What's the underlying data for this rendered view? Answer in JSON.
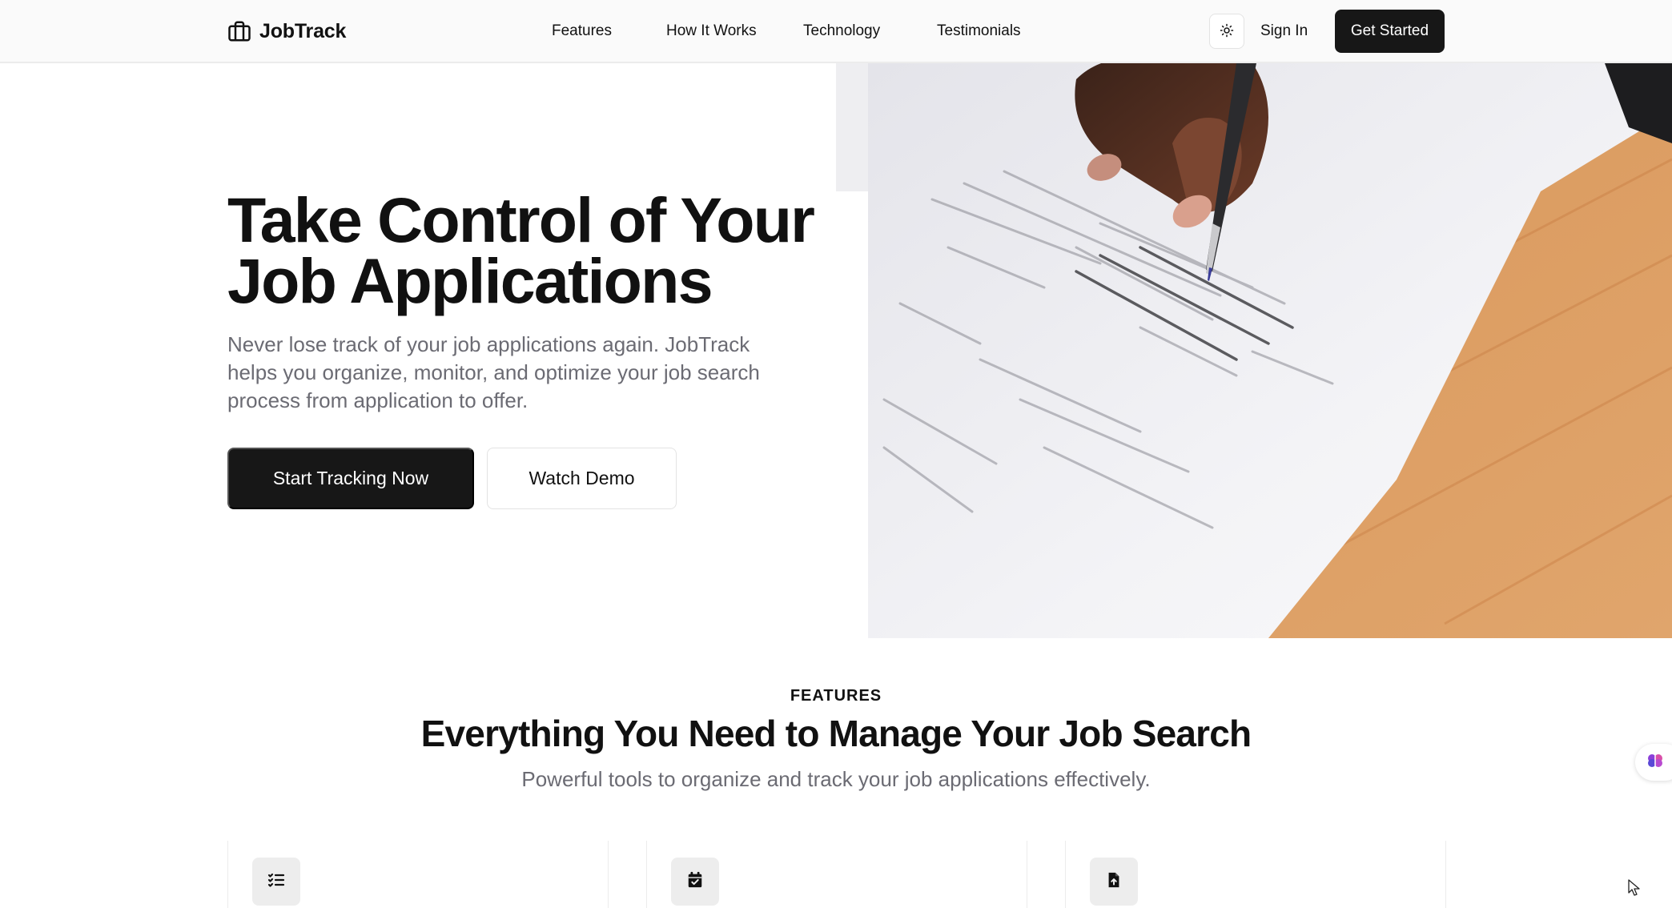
{
  "header": {
    "brand_name": "JobTrack",
    "brand_icon": "briefcase-icon",
    "nav": [
      "Features",
      "How It Works",
      "Technology",
      "Testimonials"
    ],
    "theme_toggle_icon": "sun-icon",
    "sign_in_label": "Sign In",
    "get_started_label": "Get Started"
  },
  "hero": {
    "title_line1": "Take Control of Your",
    "title_line2": "Job Applications",
    "description": "Never lose track of your job applications again. JobTrack helps you organize, monitor, and optimize your job search process from application to offer.",
    "primary_cta": "Start Tracking Now",
    "secondary_cta": "Watch Demo",
    "image_icon": "contract-signing-photo"
  },
  "features": {
    "eyebrow": "FEATURES",
    "title": "Everything You Need to Manage Your Job Search",
    "subtitle": "Powerful tools to organize and track your job applications effectively.",
    "cards": [
      {
        "icon": "checklist-icon"
      },
      {
        "icon": "calendar-check-icon"
      },
      {
        "icon": "file-upload-icon"
      }
    ]
  },
  "widget": {
    "icon": "brain-icon"
  },
  "colors": {
    "primary": "#171717",
    "muted_text": "#6b6b73",
    "navbar_bg": "#fafafa",
    "border": "#e3e3e3",
    "icon_box_bg": "#ededed"
  }
}
